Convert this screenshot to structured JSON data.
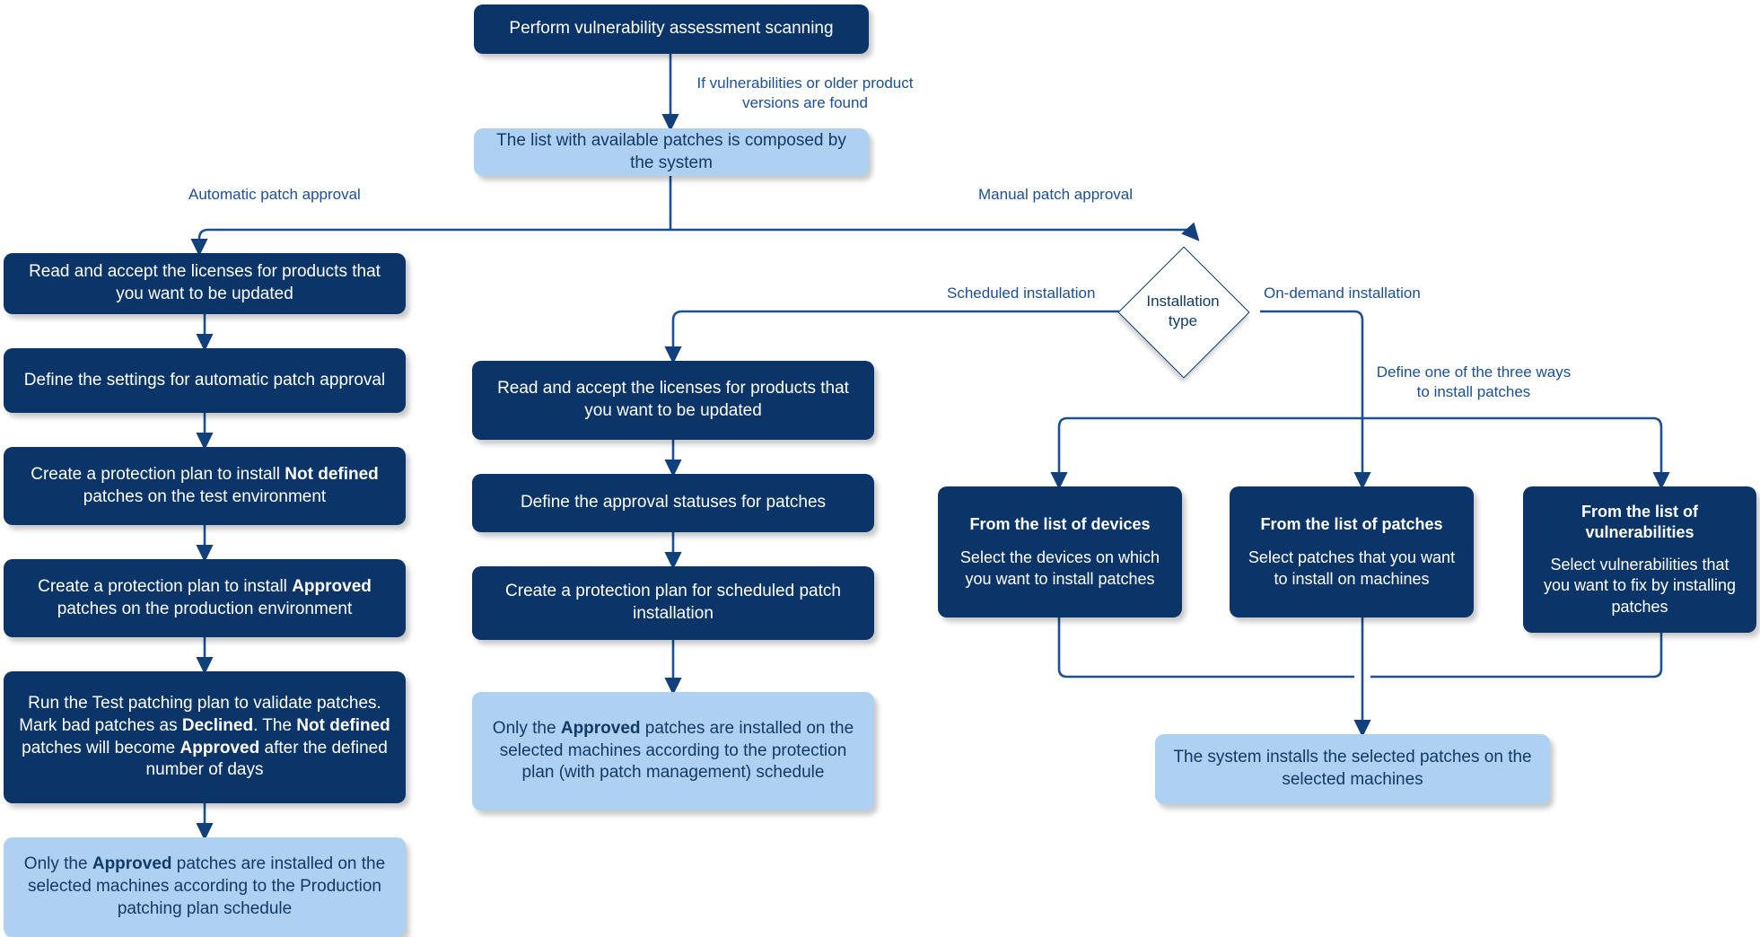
{
  "colors": {
    "dark_node": "#0b3569",
    "light_node": "#aed1f2",
    "edge": "#1b4f96",
    "label_text": "#1b4f96",
    "diamond_border": "#0b3569",
    "background": "#ffffff"
  },
  "diagram": {
    "type": "flowchart",
    "title": "Patch management workflow"
  },
  "nodes": {
    "start": {
      "label": "Perform vulnerability assessment scanning",
      "style": "dark"
    },
    "patch_list": {
      "label": "The list with available patches is composed by the system",
      "style": "light"
    },
    "auto_read_licenses": {
      "label": "Read and accept the licenses for products that you want to be updated",
      "style": "dark"
    },
    "auto_define_settings": {
      "label": "Define the settings for automatic patch approval",
      "style": "dark"
    },
    "auto_plan_not_defined": {
      "label_html": "Create a protection plan to install <b>Not defined</b> patches on the test environment",
      "style": "dark"
    },
    "auto_plan_approved": {
      "label_html": "Create a protection plan to install <b>Approved</b> patches on the production environment",
      "style": "dark"
    },
    "auto_run_test": {
      "label_html": "Run the Test patching plan to validate patches. Mark bad patches as <b>Declined</b>. The <b>Not defined</b> patches will become <b>Approved</b> after the defined number of days",
      "style": "dark"
    },
    "auto_result": {
      "label_html": "Only the <b>Approved</b> patches are installed on the selected machines according to the Production patching plan schedule",
      "style": "light"
    },
    "sched_read_licenses": {
      "label": "Read and accept the licenses for products that you want to be updated",
      "style": "dark"
    },
    "sched_define_statuses": {
      "label": "Define the approval statuses for patches",
      "style": "dark"
    },
    "sched_create_plan": {
      "label": "Create a protection plan for scheduled patch installation",
      "style": "dark"
    },
    "sched_result": {
      "label_html": "Only the <b>Approved</b> patches are installed on the selected machines according to the protection plan (with patch management) schedule",
      "style": "light"
    },
    "from_devices": {
      "title": "From the list of devices",
      "body": "Select the devices on which you want to install patches",
      "style": "dark"
    },
    "from_patches": {
      "title": "From the list of patches",
      "body": "Select patches that you want to install on machines",
      "style": "dark"
    },
    "from_vulnerabilities": {
      "title": "From the list of vulnerabilities",
      "body": "Select vulnerabilities that you want to fix by installing patches",
      "style": "dark"
    },
    "ondemand_result": {
      "label": "The system installs the selected patches on the selected machines",
      "style": "light"
    }
  },
  "decision": {
    "label": "Installation\ntype"
  },
  "edge_labels": {
    "if_vulnerabilities": "If vulnerabilities or older product\nversions are found",
    "automatic_patch_approval": "Automatic patch approval",
    "manual_patch_approval": "Manual patch approval",
    "scheduled_installation": "Scheduled installation",
    "on_demand_installation": "On-demand installation",
    "define_three_ways": "Define one of the three ways\nto install patches"
  }
}
